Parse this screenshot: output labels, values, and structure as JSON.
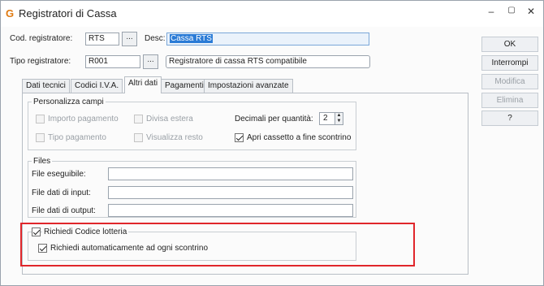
{
  "window": {
    "app_icon": "G",
    "title": "Registratori di Cassa",
    "controls": [
      "–",
      "▢",
      "✕"
    ]
  },
  "header": {
    "cod_label": "Cod. registratore:",
    "cod_value": "RTS",
    "cod_lookup": "...",
    "desc_label": "Desc:",
    "desc_value": "Cassa RTS",
    "tipo_label": "Tipo registratore:",
    "tipo_value": "R001",
    "tipo_lookup": "...",
    "tipo_desc_value": "Registratore di cassa RTS compatibile"
  },
  "tabs": [
    {
      "label": "Dati tecnici",
      "active": false
    },
    {
      "label": "Codici I.V.A.",
      "active": false
    },
    {
      "label": "Altri dati",
      "active": true
    },
    {
      "label": "Pagamenti",
      "active": false
    },
    {
      "label": "Impostazioni avanzate",
      "active": false
    }
  ],
  "personalizza": {
    "title": "Personalizza campi",
    "importo_pagamento": {
      "label": "Importo pagamento",
      "checked": false,
      "enabled": false
    },
    "divisa_estera": {
      "label": "Divisa estera",
      "checked": false,
      "enabled": false
    },
    "tipo_pagamento": {
      "label": "Tipo pagamento",
      "checked": false,
      "enabled": false
    },
    "visualizza_resto": {
      "label": "Visualizza resto",
      "checked": false,
      "enabled": false
    },
    "decimali_label": "Decimali per quantità:",
    "decimali_value": "2",
    "apri_cassetto": {
      "label": "Apri cassetto a fine scontrino",
      "checked": true,
      "enabled": true
    }
  },
  "files": {
    "title": "Files",
    "eseguibile_label": "File eseguibile:",
    "eseguibile_value": "",
    "input_label": "File dati di input:",
    "input_value": "",
    "output_label": "File dati di output:",
    "output_value": ""
  },
  "lotteria": {
    "richiedi_codice": {
      "label": "Richiedi Codice lotteria",
      "checked": true
    },
    "richiedi_auto": {
      "label": "Richiedi automaticamente ad ogni scontrino",
      "checked": true
    }
  },
  "actions": {
    "ok": "OK",
    "interrompi": "Interrompi",
    "modifica": "Modifica",
    "elimina": "Elimina",
    "help": "?"
  },
  "colors": {
    "accent_highlight": "#e0262b",
    "selected_text_bg": "#2a7bd6",
    "app_icon": "#e07a10"
  }
}
